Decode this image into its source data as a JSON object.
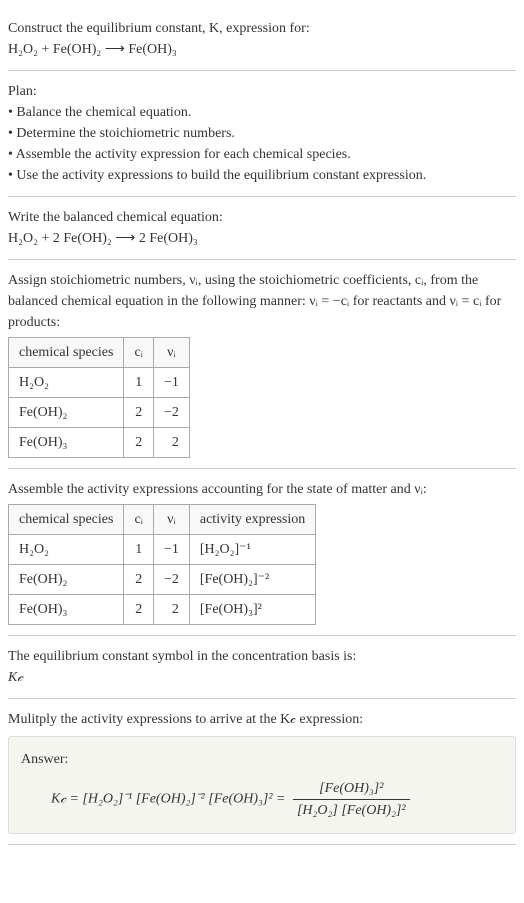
{
  "intro": {
    "line1": "Construct the equilibrium constant, K, expression for:",
    "equation": "H₂O₂ + Fe(OH)₂ ⟶ Fe(OH)₃"
  },
  "plan": {
    "title": "Plan:",
    "steps": [
      "Balance the chemical equation.",
      "Determine the stoichiometric numbers.",
      "Assemble the activity expression for each chemical species.",
      "Use the activity expressions to build the equilibrium constant expression."
    ]
  },
  "balanced": {
    "title": "Write the balanced chemical equation:",
    "equation": "H₂O₂ + 2 Fe(OH)₂ ⟶ 2 Fe(OH)₃"
  },
  "stoich": {
    "intro": "Assign stoichiometric numbers, νᵢ, using the stoichiometric coefficients, cᵢ, from the balanced chemical equation in the following manner: νᵢ = −cᵢ for reactants and νᵢ = cᵢ for products:",
    "headers": {
      "species": "chemical species",
      "ci": "cᵢ",
      "vi": "νᵢ"
    },
    "rows": [
      {
        "species": "H₂O₂",
        "ci": "1",
        "vi": "−1"
      },
      {
        "species": "Fe(OH)₂",
        "ci": "2",
        "vi": "−2"
      },
      {
        "species": "Fe(OH)₃",
        "ci": "2",
        "vi": "2"
      }
    ]
  },
  "activity": {
    "intro": "Assemble the activity expressions accounting for the state of matter and νᵢ:",
    "headers": {
      "species": "chemical species",
      "ci": "cᵢ",
      "vi": "νᵢ",
      "expr": "activity expression"
    },
    "rows": [
      {
        "species": "H₂O₂",
        "ci": "1",
        "vi": "−1",
        "expr": "[H₂O₂]⁻¹"
      },
      {
        "species": "Fe(OH)₂",
        "ci": "2",
        "vi": "−2",
        "expr": "[Fe(OH)₂]⁻²"
      },
      {
        "species": "Fe(OH)₃",
        "ci": "2",
        "vi": "2",
        "expr": "[Fe(OH)₃]²"
      }
    ]
  },
  "symbol": {
    "line": "The equilibrium constant symbol in the concentration basis is:",
    "kc": "K𝒸"
  },
  "multiply": {
    "line": "Mulitply the activity expressions to arrive at the K𝒸 expression:"
  },
  "answer": {
    "label": "Answer:",
    "kc_product": "K𝒸 = [H₂O₂]⁻¹ [Fe(OH)₂]⁻² [Fe(OH)₃]² =",
    "numerator": "[Fe(OH)₃]²",
    "denominator": "[H₂O₂] [Fe(OH)₂]²"
  },
  "chart_data": {
    "type": "table",
    "tables": [
      {
        "title": "Stoichiometric numbers",
        "columns": [
          "chemical species",
          "cᵢ",
          "νᵢ"
        ],
        "rows": [
          [
            "H₂O₂",
            1,
            -1
          ],
          [
            "Fe(OH)₂",
            2,
            -2
          ],
          [
            "Fe(OH)₃",
            2,
            2
          ]
        ]
      },
      {
        "title": "Activity expressions",
        "columns": [
          "chemical species",
          "cᵢ",
          "νᵢ",
          "activity expression"
        ],
        "rows": [
          [
            "H₂O₂",
            1,
            -1,
            "[H₂O₂]⁻¹"
          ],
          [
            "Fe(OH)₂",
            2,
            -2,
            "[Fe(OH)₂]⁻²"
          ],
          [
            "Fe(OH)₃",
            2,
            2,
            "[Fe(OH)₃]²"
          ]
        ]
      }
    ]
  }
}
